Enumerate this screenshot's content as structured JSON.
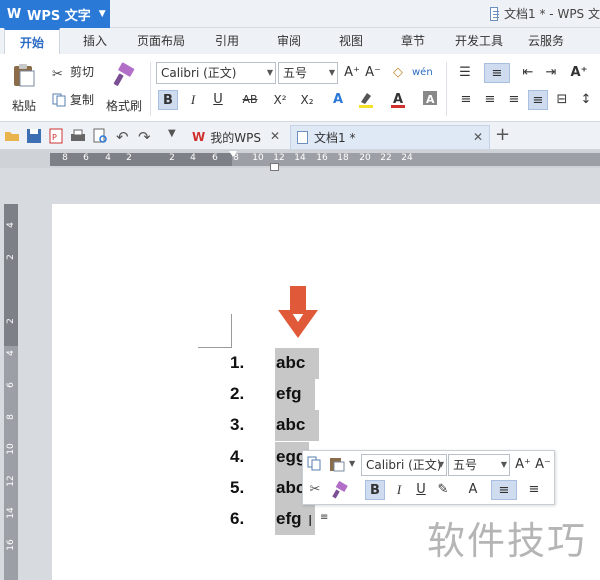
{
  "app": {
    "name": "WPS 文字",
    "doc_title": "文档1 * - WPS 文"
  },
  "menu_tabs": [
    "开始",
    "插入",
    "页面布局",
    "引用",
    "审阅",
    "视图",
    "章节",
    "开发工具",
    "云服务"
  ],
  "ribbon": {
    "paste": "粘贴",
    "cut": "剪切",
    "copy": "复制",
    "format_painter": "格式刷",
    "font_name": "Calibri (正文)",
    "font_size": "五号",
    "bold": "B",
    "italic": "I",
    "underline": "U",
    "strike": "AB",
    "superscript": "X²",
    "subscript": "X₂",
    "grow": "A⁺",
    "shrink": "A⁻"
  },
  "doc_tabs": [
    {
      "label": "我的WPS",
      "active": false
    },
    {
      "label": "文档1 *",
      "active": true
    }
  ],
  "ruler_h": [
    "8",
    "6",
    "4",
    "2",
    "",
    "2",
    "4",
    "6",
    "8",
    "10",
    "12",
    "14",
    "16",
    "18",
    "20",
    "22",
    "24"
  ],
  "ruler_v": [
    "4",
    "2",
    "",
    "2",
    "4",
    "6",
    "8",
    "10",
    "12",
    "14",
    "16"
  ],
  "list": [
    {
      "num": "1.",
      "text": "abc"
    },
    {
      "num": "2.",
      "text": "efg"
    },
    {
      "num": "3.",
      "text": "abc"
    },
    {
      "num": "4.",
      "text": "egg"
    },
    {
      "num": "5.",
      "text": "abc"
    },
    {
      "num": "6.",
      "text": "efg"
    }
  ],
  "mini_toolbar": {
    "font_name": "Calibri (正文)",
    "font_size": "五号",
    "bold": "B",
    "italic": "I",
    "underline": "U"
  },
  "watermark": "软件技巧",
  "colors": {
    "accent": "#2b79d6",
    "arrow": "#e05a3a",
    "selection": "#c7c7c7"
  }
}
